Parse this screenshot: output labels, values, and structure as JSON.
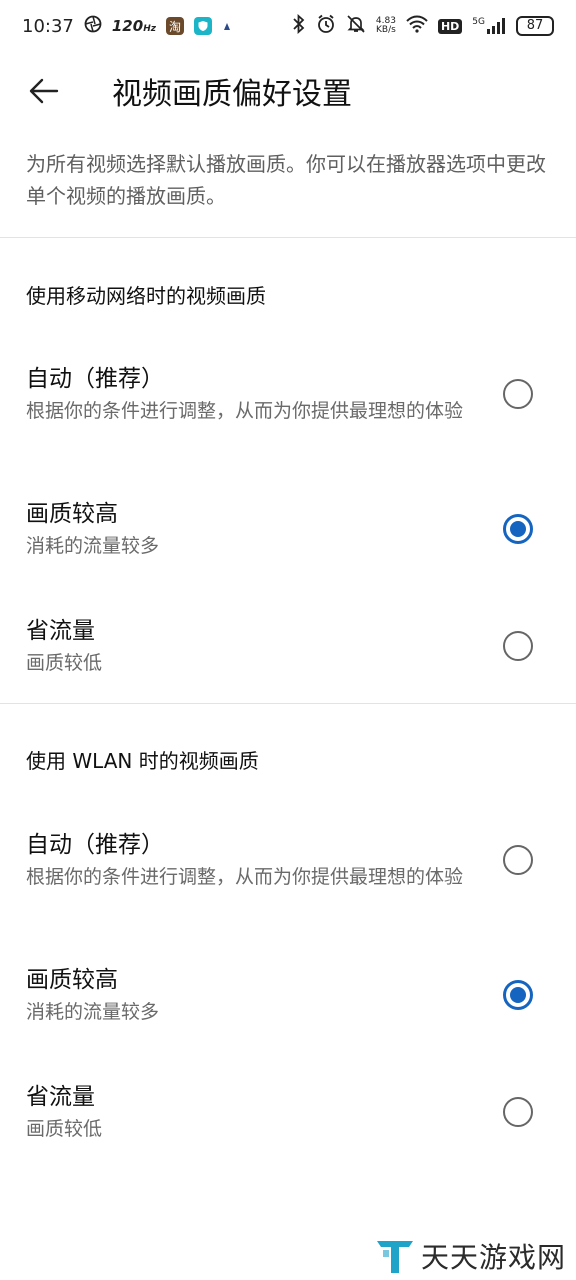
{
  "status_bar": {
    "time": "10:37",
    "refresh_rate": "120",
    "refresh_unit": "Hz",
    "net_speed_value": "4.83",
    "net_speed_unit": "KB/s",
    "hd": "HD",
    "network": "5G",
    "battery": "87"
  },
  "header": {
    "title": "视频画质偏好设置"
  },
  "intro": "为所有视频选择默认播放画质。你可以在播放器选项中更改单个视频的播放画质。",
  "sections": [
    {
      "title": "使用移动网络时的视频画质",
      "options": [
        {
          "label": "自动（推荐）",
          "desc": "根据你的条件进行调整，从而为你提供最理想的体验",
          "selected": false
        },
        {
          "label": "画质较高",
          "desc": "消耗的流量较多",
          "selected": true
        },
        {
          "label": "省流量",
          "desc": "画质较低",
          "selected": false
        }
      ]
    },
    {
      "title": "使用 WLAN 时的视频画质",
      "options": [
        {
          "label": "自动（推荐）",
          "desc": "根据你的条件进行调整，从而为你提供最理想的体验",
          "selected": false
        },
        {
          "label": "画质较高",
          "desc": "消耗的流量较多",
          "selected": true
        },
        {
          "label": "省流量",
          "desc": "画质较低",
          "selected": false
        }
      ]
    }
  ],
  "watermark": {
    "text": "天天游戏网"
  },
  "colors": {
    "accent": "#1565c0",
    "text_primary": "#111111",
    "text_secondary": "#6a6a6a"
  }
}
